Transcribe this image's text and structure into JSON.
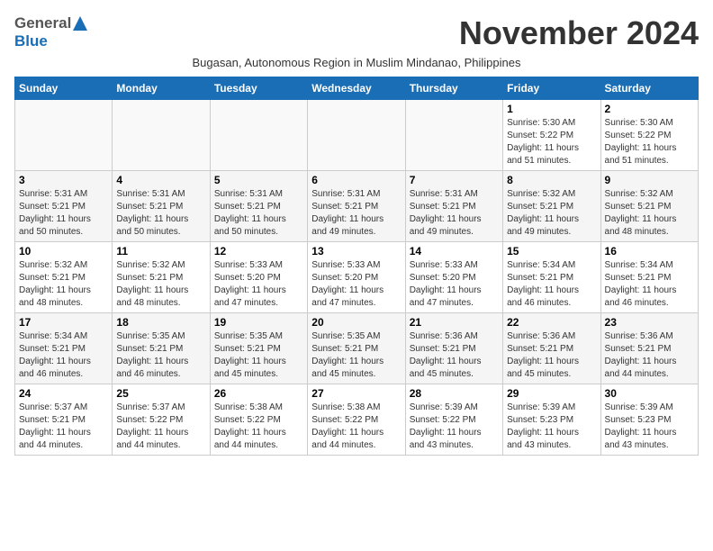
{
  "header": {
    "logo_general": "General",
    "logo_blue": "Blue",
    "month_title": "November 2024",
    "subtitle": "Bugasan, Autonomous Region in Muslim Mindanao, Philippines"
  },
  "calendar": {
    "days_of_week": [
      "Sunday",
      "Monday",
      "Tuesday",
      "Wednesday",
      "Thursday",
      "Friday",
      "Saturday"
    ],
    "weeks": [
      [
        {
          "day": "",
          "info": ""
        },
        {
          "day": "",
          "info": ""
        },
        {
          "day": "",
          "info": ""
        },
        {
          "day": "",
          "info": ""
        },
        {
          "day": "",
          "info": ""
        },
        {
          "day": "1",
          "info": "Sunrise: 5:30 AM\nSunset: 5:22 PM\nDaylight: 11 hours\nand 51 minutes."
        },
        {
          "day": "2",
          "info": "Sunrise: 5:30 AM\nSunset: 5:22 PM\nDaylight: 11 hours\nand 51 minutes."
        }
      ],
      [
        {
          "day": "3",
          "info": "Sunrise: 5:31 AM\nSunset: 5:21 PM\nDaylight: 11 hours\nand 50 minutes."
        },
        {
          "day": "4",
          "info": "Sunrise: 5:31 AM\nSunset: 5:21 PM\nDaylight: 11 hours\nand 50 minutes."
        },
        {
          "day": "5",
          "info": "Sunrise: 5:31 AM\nSunset: 5:21 PM\nDaylight: 11 hours\nand 50 minutes."
        },
        {
          "day": "6",
          "info": "Sunrise: 5:31 AM\nSunset: 5:21 PM\nDaylight: 11 hours\nand 49 minutes."
        },
        {
          "day": "7",
          "info": "Sunrise: 5:31 AM\nSunset: 5:21 PM\nDaylight: 11 hours\nand 49 minutes."
        },
        {
          "day": "8",
          "info": "Sunrise: 5:32 AM\nSunset: 5:21 PM\nDaylight: 11 hours\nand 49 minutes."
        },
        {
          "day": "9",
          "info": "Sunrise: 5:32 AM\nSunset: 5:21 PM\nDaylight: 11 hours\nand 48 minutes."
        }
      ],
      [
        {
          "day": "10",
          "info": "Sunrise: 5:32 AM\nSunset: 5:21 PM\nDaylight: 11 hours\nand 48 minutes."
        },
        {
          "day": "11",
          "info": "Sunrise: 5:32 AM\nSunset: 5:21 PM\nDaylight: 11 hours\nand 48 minutes."
        },
        {
          "day": "12",
          "info": "Sunrise: 5:33 AM\nSunset: 5:20 PM\nDaylight: 11 hours\nand 47 minutes."
        },
        {
          "day": "13",
          "info": "Sunrise: 5:33 AM\nSunset: 5:20 PM\nDaylight: 11 hours\nand 47 minutes."
        },
        {
          "day": "14",
          "info": "Sunrise: 5:33 AM\nSunset: 5:20 PM\nDaylight: 11 hours\nand 47 minutes."
        },
        {
          "day": "15",
          "info": "Sunrise: 5:34 AM\nSunset: 5:21 PM\nDaylight: 11 hours\nand 46 minutes."
        },
        {
          "day": "16",
          "info": "Sunrise: 5:34 AM\nSunset: 5:21 PM\nDaylight: 11 hours\nand 46 minutes."
        }
      ],
      [
        {
          "day": "17",
          "info": "Sunrise: 5:34 AM\nSunset: 5:21 PM\nDaylight: 11 hours\nand 46 minutes."
        },
        {
          "day": "18",
          "info": "Sunrise: 5:35 AM\nSunset: 5:21 PM\nDaylight: 11 hours\nand 46 minutes."
        },
        {
          "day": "19",
          "info": "Sunrise: 5:35 AM\nSunset: 5:21 PM\nDaylight: 11 hours\nand 45 minutes."
        },
        {
          "day": "20",
          "info": "Sunrise: 5:35 AM\nSunset: 5:21 PM\nDaylight: 11 hours\nand 45 minutes."
        },
        {
          "day": "21",
          "info": "Sunrise: 5:36 AM\nSunset: 5:21 PM\nDaylight: 11 hours\nand 45 minutes."
        },
        {
          "day": "22",
          "info": "Sunrise: 5:36 AM\nSunset: 5:21 PM\nDaylight: 11 hours\nand 45 minutes."
        },
        {
          "day": "23",
          "info": "Sunrise: 5:36 AM\nSunset: 5:21 PM\nDaylight: 11 hours\nand 44 minutes."
        }
      ],
      [
        {
          "day": "24",
          "info": "Sunrise: 5:37 AM\nSunset: 5:21 PM\nDaylight: 11 hours\nand 44 minutes."
        },
        {
          "day": "25",
          "info": "Sunrise: 5:37 AM\nSunset: 5:22 PM\nDaylight: 11 hours\nand 44 minutes."
        },
        {
          "day": "26",
          "info": "Sunrise: 5:38 AM\nSunset: 5:22 PM\nDaylight: 11 hours\nand 44 minutes."
        },
        {
          "day": "27",
          "info": "Sunrise: 5:38 AM\nSunset: 5:22 PM\nDaylight: 11 hours\nand 44 minutes."
        },
        {
          "day": "28",
          "info": "Sunrise: 5:39 AM\nSunset: 5:22 PM\nDaylight: 11 hours\nand 43 minutes."
        },
        {
          "day": "29",
          "info": "Sunrise: 5:39 AM\nSunset: 5:23 PM\nDaylight: 11 hours\nand 43 minutes."
        },
        {
          "day": "30",
          "info": "Sunrise: 5:39 AM\nSunset: 5:23 PM\nDaylight: 11 hours\nand 43 minutes."
        }
      ]
    ]
  }
}
